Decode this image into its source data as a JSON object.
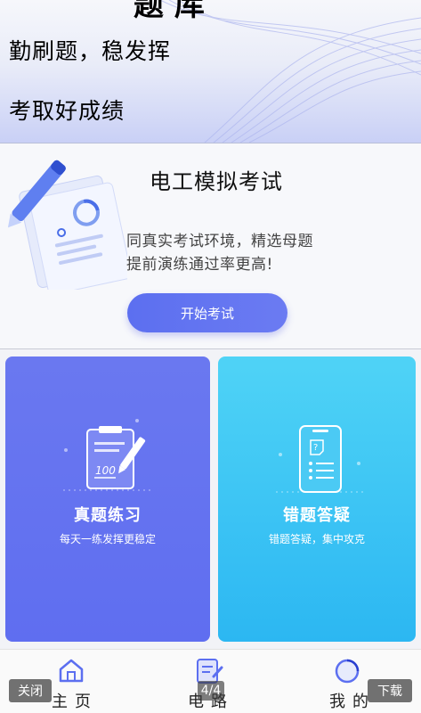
{
  "header": {
    "top_text": "题 库",
    "slogan_line1": "勤刷题，稳发挥",
    "slogan_line2": "考取好成绩"
  },
  "exam": {
    "title": "电工模拟考试",
    "desc_line1": "同真实考试环境，精选母题",
    "desc_line2": "提前演练通过率更高!",
    "start_label": "开始考试"
  },
  "tiles": [
    {
      "title": "真题练习",
      "subtitle": "每天一练发挥更稳定",
      "color": "#6673f0"
    },
    {
      "title": "错题答疑",
      "subtitle": "错题答疑，集中攻克",
      "color": "#3cc4f4"
    }
  ],
  "nav": {
    "items": [
      {
        "label": "主页",
        "icon": "home-icon"
      },
      {
        "label": "电路",
        "icon": "circuit-icon"
      },
      {
        "label": "我的",
        "icon": "profile-icon"
      }
    ]
  },
  "overlay": {
    "close_label": "关闭",
    "download_label": "下载",
    "page_indicator": "4/4"
  },
  "colors": {
    "accent": "#5c6ff0",
    "tile_left": "#6673f0",
    "tile_right": "#3cc4f4"
  }
}
